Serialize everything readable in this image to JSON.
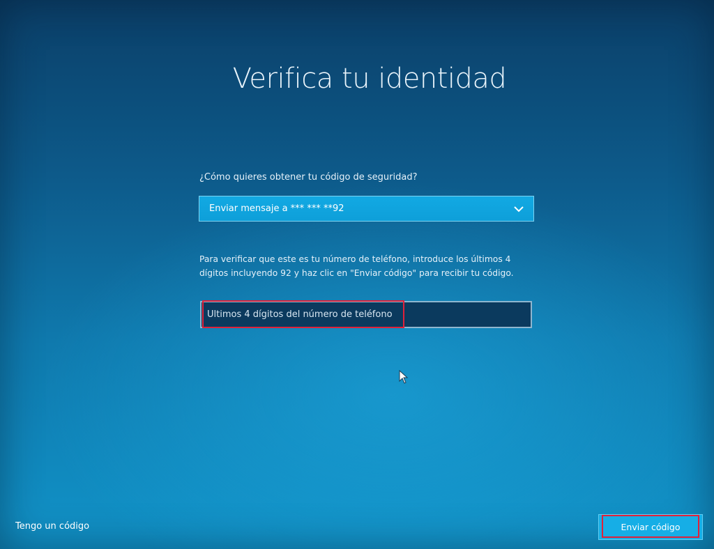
{
  "page": {
    "title": "Verifica tu identidad"
  },
  "method": {
    "label": "¿Cómo quieres obtener tu código de seguridad?",
    "selected_option": "Enviar mensaje a *** *** **92"
  },
  "instructions": {
    "text": "Para verificar que este es tu número de teléfono, introduce los últimos 4 dígitos incluyendo 92 y haz clic en \"Enviar código\" para recibir tu código."
  },
  "digits_input": {
    "placeholder": "Últimos 4 dígitos del número de teléfono",
    "value": ""
  },
  "footer": {
    "have_code_label": "Tengo un código",
    "send_code_label": "Enviar código"
  },
  "icons": {
    "dropdown": "chevron-down-icon",
    "cursor": "mouse-cursor-icon"
  },
  "colors": {
    "background_top": "#0b3f68",
    "background_bottom": "#1193c8",
    "accent": "#12a9e3",
    "highlight": "#e0213a"
  }
}
